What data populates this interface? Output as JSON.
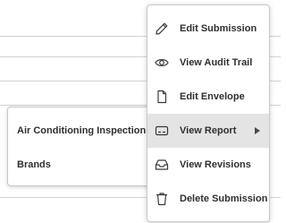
{
  "menu": {
    "items": [
      {
        "label": "Edit Submission",
        "icon": "pencil-icon"
      },
      {
        "label": "View Audit Trail",
        "icon": "eye-icon"
      },
      {
        "label": "Edit Envelope",
        "icon": "document-icon"
      },
      {
        "label": "View Report",
        "icon": "report-icon",
        "has_submenu": true,
        "active": true
      },
      {
        "label": "View Revisions",
        "icon": "inbox-icon"
      },
      {
        "label": "Delete Submission",
        "icon": "trash-icon"
      }
    ]
  },
  "submenu": {
    "items": [
      {
        "label": "Air Conditioning Inspection"
      },
      {
        "label": "Brands"
      }
    ]
  },
  "colors": {
    "menu_text": "#2f2f2f",
    "active_background": "#e4e4e4",
    "border": "#c9c9c9",
    "background_line": "#d2d2d2"
  }
}
